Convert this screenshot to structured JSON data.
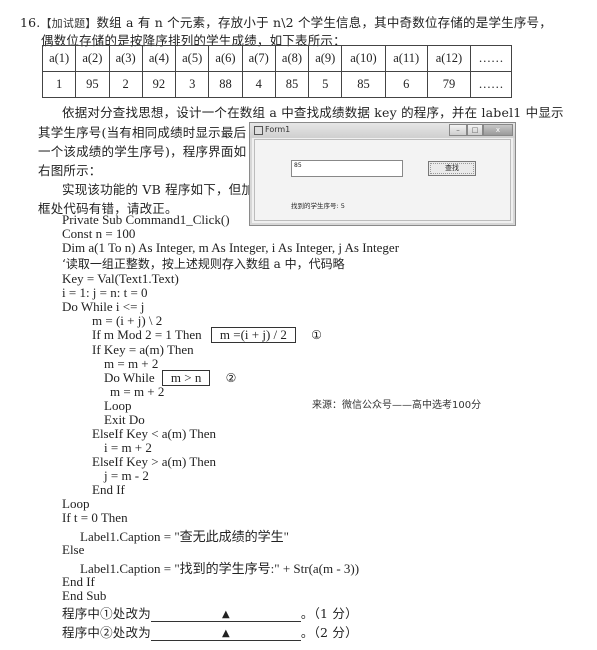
{
  "question": {
    "number": "16.",
    "tag": "【加试题】",
    "line1": "数组 a 有 n 个元素，存放小于 n\\2 个学生信息，其中奇数位存储的是学生序号，",
    "line2": "偶数位存储的是按降序排列的学生成绩，如下表所示："
  },
  "array_table": {
    "headers": [
      "a(1)",
      "a(2)",
      "a(3)",
      "a(4)",
      "a(5)",
      "a(6)",
      "a(7)",
      "a(8)",
      "a(9)",
      "a(10)",
      "a(11)",
      "a(12)",
      "……"
    ],
    "values": [
      "1",
      "95",
      "2",
      "92",
      "3",
      "88",
      "4",
      "85",
      "5",
      "85",
      "6",
      "79",
      "……"
    ]
  },
  "description": {
    "p1_line1": "依据对分查找思想，设计一个在数组 a 中查找成绩数据 key 的程序，并在 label1 中显示",
    "p1_line2": "其学生序号(当有相同成绩时显示最后",
    "p1_line3": "一个该成绩的学生序号)，程序界面如",
    "p1_line4": "右图所示：",
    "p2_line1": "实现该功能的 VB 程序如下，但加",
    "p2_line2": "框处代码有错，请改正。"
  },
  "form_window": {
    "title": "Form1",
    "textbox_value": "85",
    "button_label": "查找",
    "label_text": "找到的学生序号: 5",
    "minimize": "–",
    "maximize": "□",
    "close": "x"
  },
  "code": {
    "lines": [
      "Private Sub Command1_Click()",
      "Const n = 100",
      "Dim a(1 To n) As Integer, m As Integer, i As Integer, j As Integer",
      "‘读取一组正整数，按上述规则存入数组 a 中，代码略",
      "Key = Val(Text1.Text)",
      "i = 1: j = n: t = 0",
      "Do While i <= j",
      "m = (i + j) \\ 2",
      "If m Mod 2 = 1 Then",
      "If Key = a(m) Then",
      "m = m + 2",
      "Do While",
      "m = m + 2",
      "Loop",
      "Exit Do",
      "ElseIf Key < a(m) Then",
      "i = m + 2",
      "ElseIf Key > a(m) Then",
      "j = m - 2",
      "End If",
      "Loop",
      "If t = 0 Then",
      "Label1.Caption = \"查无此成绩的学生\"",
      "Else",
      "Label1.Caption = \"找到的学生序号:\" + Str(a(m - 3))",
      "End If",
      "End Sub"
    ],
    "box1": "m =(i + j) / 2",
    "box1_mark": "①",
    "box2": "m > n",
    "box2_mark": "②"
  },
  "source_note": "来源：微信公众号——高中选考100分",
  "answers": [
    {
      "prefix": "程序中①处改为",
      "blank_mark": "▲",
      "suffix": "。（1 分）"
    },
    {
      "prefix": "程序中②处改为",
      "blank_mark": "▲",
      "suffix": "。（2 分）"
    }
  ]
}
